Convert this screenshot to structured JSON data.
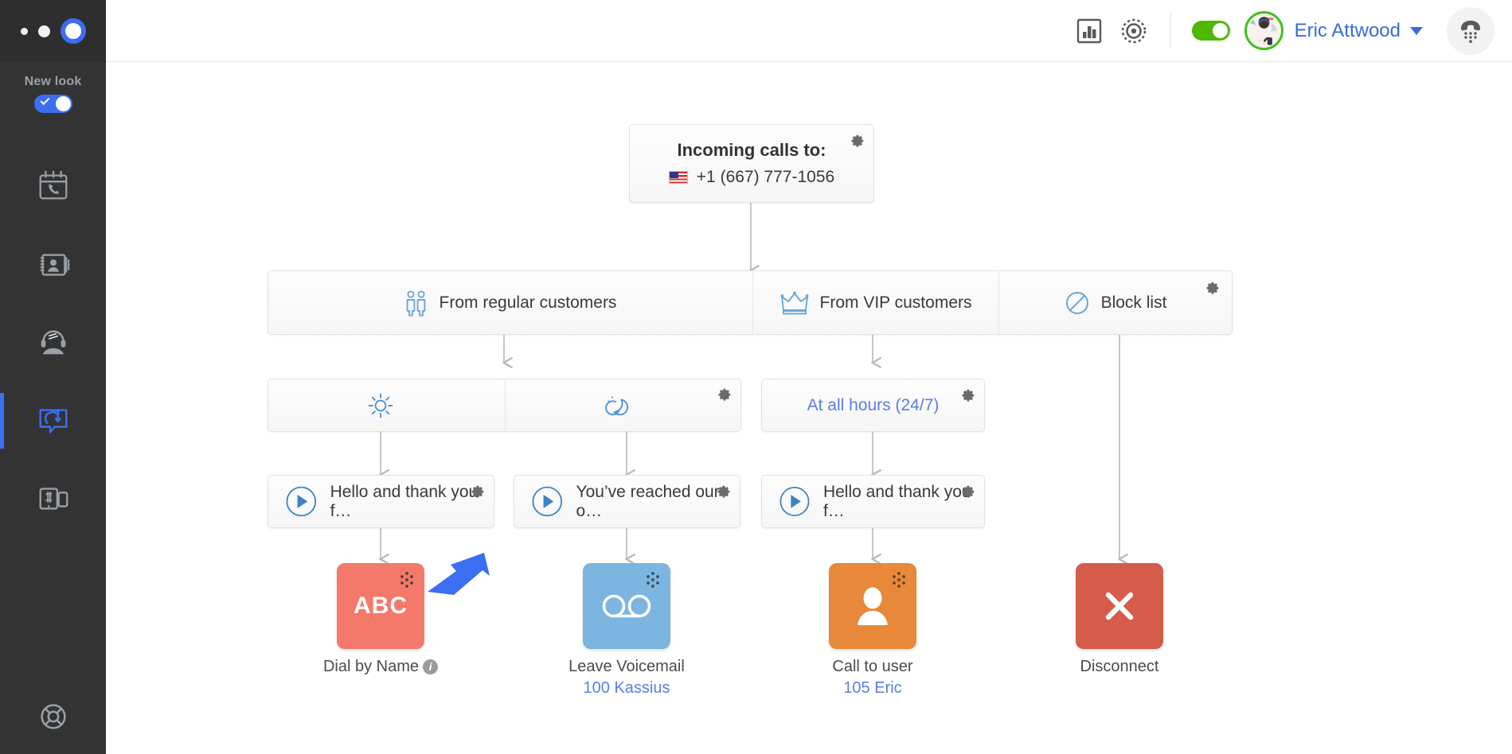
{
  "sidebar": {
    "new_look_label": "New look",
    "new_look_enabled": "on",
    "items": [
      {
        "icon": "calendar-phone-icon",
        "name": "call-history",
        "active": "false"
      },
      {
        "icon": "address-book-icon",
        "name": "contacts",
        "active": "false"
      },
      {
        "icon": "headset-agent-icon",
        "name": "agents",
        "active": "false"
      },
      {
        "icon": "call-flow-icon",
        "name": "call-flows",
        "active": "true"
      },
      {
        "icon": "devices-hash-icon",
        "name": "devices",
        "active": "false"
      }
    ],
    "bottom_item": {
      "icon": "lifebuoy-icon",
      "name": "support"
    }
  },
  "topbar": {
    "reports_icon": "bar-chart-icon",
    "settings_icon": "gear-target-icon",
    "status_toggle": "on",
    "status_color": "#4eb803",
    "user_name": "Eric Attwood",
    "user_chevron": "chevron-down-icon",
    "dialpad_icon": "dialpad-handset-icon"
  },
  "flow": {
    "root": {
      "title": "Incoming calls to:",
      "number": "+1 (667) 777-1056",
      "flag": "us-flag-icon",
      "gear": "gear-icon"
    },
    "caller_groups": [
      {
        "label": "From regular customers",
        "icon": "two-people-icon"
      },
      {
        "label": "From VIP customers",
        "icon": "crown-icon"
      },
      {
        "label": "Block list",
        "icon": "block-circle-icon"
      }
    ],
    "schedules_left": [
      {
        "label": "",
        "icon": "sun-icon"
      },
      {
        "label": "",
        "icon": "moon-icon"
      }
    ],
    "schedule_right": {
      "label": "At all hours (24/7)",
      "gear": "gear-icon"
    },
    "greetings": [
      {
        "label": "Hello and thank you f…",
        "icon": "play-circle-icon",
        "gear": "gear-icon"
      },
      {
        "label": "You’ve reached our o…",
        "icon": "play-circle-icon",
        "gear": "gear-icon"
      },
      {
        "label": "Hello and thank you f…",
        "icon": "play-circle-icon",
        "gear": "gear-icon"
      }
    ],
    "actions": [
      {
        "caption": "Dial by Name",
        "sub": "",
        "icon": "abc-icon",
        "glyph": "ABC",
        "color": "#f4796b",
        "has_info": "true",
        "grip": "drag-grip-icon"
      },
      {
        "caption": "Leave Voicemail",
        "sub": "100 Kassius",
        "icon": "voicemail-icon",
        "glyph": "",
        "color": "#7cb5e0",
        "has_info": "false",
        "grip": "drag-grip-icon"
      },
      {
        "caption": "Call to user",
        "sub": "105 Eric",
        "icon": "user-silhouette-icon",
        "glyph": "",
        "color": "#e8883b",
        "has_info": "false",
        "grip": "drag-grip-icon"
      },
      {
        "caption": "Disconnect",
        "sub": "",
        "icon": "close-x-icon",
        "glyph": "",
        "color": "#d65b4a",
        "has_info": "false",
        "grip": "drag-grip-icon"
      }
    ],
    "annotation_arrow": {
      "icon": "pointer-arrow-icon",
      "color": "#3b6ef0"
    }
  }
}
